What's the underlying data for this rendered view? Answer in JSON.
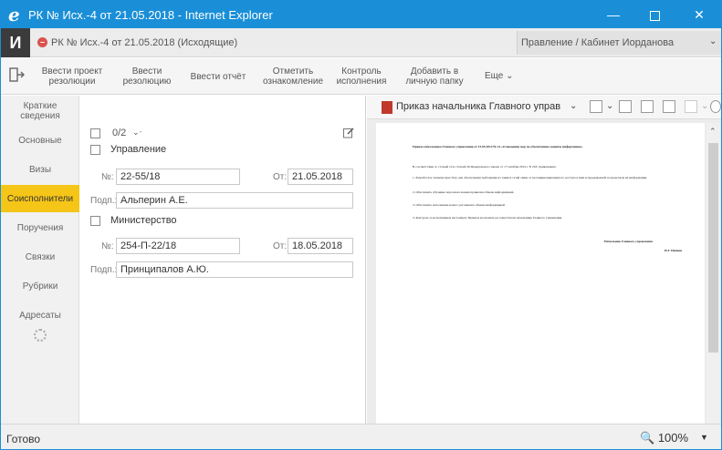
{
  "window": {
    "title": "РК № Исх.-4 от 21.05.2018 - Internet Explorer",
    "browser_icon": "internet-explorer-icon",
    "title_bar_color": "#1a8fd8"
  },
  "doc_header": {
    "app_logo": "И",
    "doc_title": "РК № Исх.-4 от 21.05.2018 (Исходящие)",
    "user": "Правление / Кабинет Иорданова"
  },
  "toolbar": {
    "items": [
      {
        "label": "Ввести проект\nрезолюции"
      },
      {
        "label": "Ввести\nрезолюцию"
      },
      {
        "label": "Ввести отчёт"
      },
      {
        "label": "Отметить\nознакомление"
      },
      {
        "label": "Контроль\nисполнения"
      },
      {
        "label": "Добавить в\nличную папку"
      }
    ],
    "more": "Еще"
  },
  "nav": {
    "items": [
      {
        "label": "Краткие\nсведения",
        "active": false
      },
      {
        "label": "Основные",
        "active": false
      },
      {
        "label": "Визы",
        "active": false
      },
      {
        "label": "Соисполнители",
        "active": true
      },
      {
        "label": "Поручения",
        "active": false
      },
      {
        "label": "Связки",
        "active": false
      },
      {
        "label": "Рубрики",
        "active": false
      },
      {
        "label": "Адресаты",
        "active": false
      }
    ],
    "active_color": "#f5c518"
  },
  "form": {
    "counter": "0/2",
    "entries": [
      {
        "org": "Управление",
        "num_label": "№:",
        "num": "22-55/18",
        "date_label": "От:",
        "date": "21.05.2018",
        "signer_label": "Подп.:",
        "signer": "Альперин А.Е."
      },
      {
        "org": "Министерство",
        "num_label": "№:",
        "num": "254-П-22/18",
        "date_label": "От:",
        "date": "18.05.2018",
        "signer_label": "Подп.:",
        "signer": "Принципалов А.Ю."
      }
    ]
  },
  "preview": {
    "file_title": "Приказ начальника Главного управлен...",
    "page": {
      "heading": "Приказ начальника Главного управления от 15.05.2014 № 14 «О введении мер по обеспечению защиты информации».",
      "intro": "В соответствии со статьей 12 и статьей 26 Федерального закона от 17 октября 2014 г. N 218- приказываю:",
      "items": [
        "1. Разработать техническую базу для обеспечения требования по защите сетей связи от несанкционированного доступа к ним и передаваемой посредством их информации.",
        "2. Обеспечить обучение персонала новым правилам обмена информацией.",
        "3. Обеспечить исполнение нового регламента обмена информацией.",
        "3. Контроль за исполнением настоящего Приказа возложить на заместителя начальника Главного управления."
      ],
      "sign_title": "Начальник Главного управления",
      "sign_name": "И.Г. Иванов"
    }
  },
  "status": {
    "text": "Готово",
    "zoom": "100%"
  }
}
